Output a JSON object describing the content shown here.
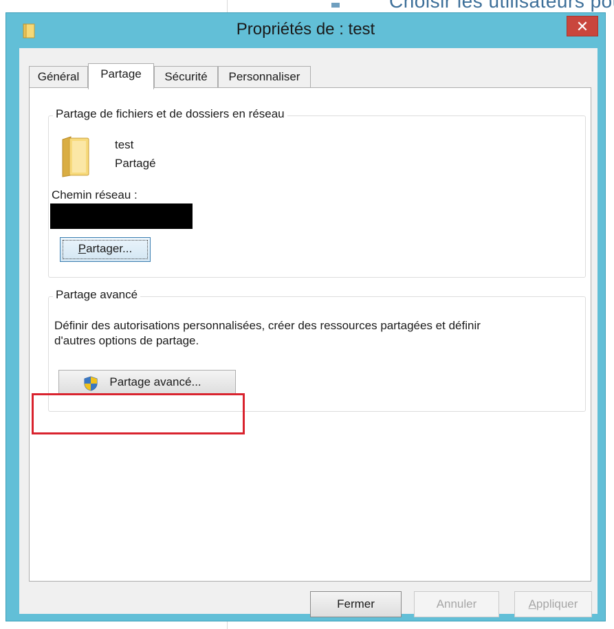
{
  "background": {
    "partial_text": "Choisir les utilisateurs pou"
  },
  "window": {
    "title": "Propriétés de : test",
    "close_glyph": "✕"
  },
  "tabs": [
    {
      "label": "Général"
    },
    {
      "label": "Partage"
    },
    {
      "label": "Sécurité"
    },
    {
      "label": "Personnaliser"
    }
  ],
  "network_sharing": {
    "legend": "Partage de fichiers et de dossiers en réseau",
    "folder_name": "test",
    "status": "Partagé",
    "path_label": "Chemin réseau :",
    "share_button": {
      "before": "",
      "underlined": "P",
      "after": "artager..."
    }
  },
  "advanced_sharing": {
    "legend": "Partage avancé",
    "description_line1": "Définir des autorisations personnalisées, créer des ressources partagées et définir",
    "description_line2": "d'autres options de partage.",
    "button": {
      "before": "Parta",
      "underlined": "g",
      "after": "e avancé..."
    }
  },
  "footer": {
    "close_label": "Fermer",
    "cancel_label": "Annuler",
    "apply": {
      "before": "",
      "underlined": "A",
      "after": "ppliquer"
    }
  },
  "colors": {
    "window_frame": "#62bfd7",
    "close_button": "#c9463d",
    "highlight": "#d9232e"
  }
}
